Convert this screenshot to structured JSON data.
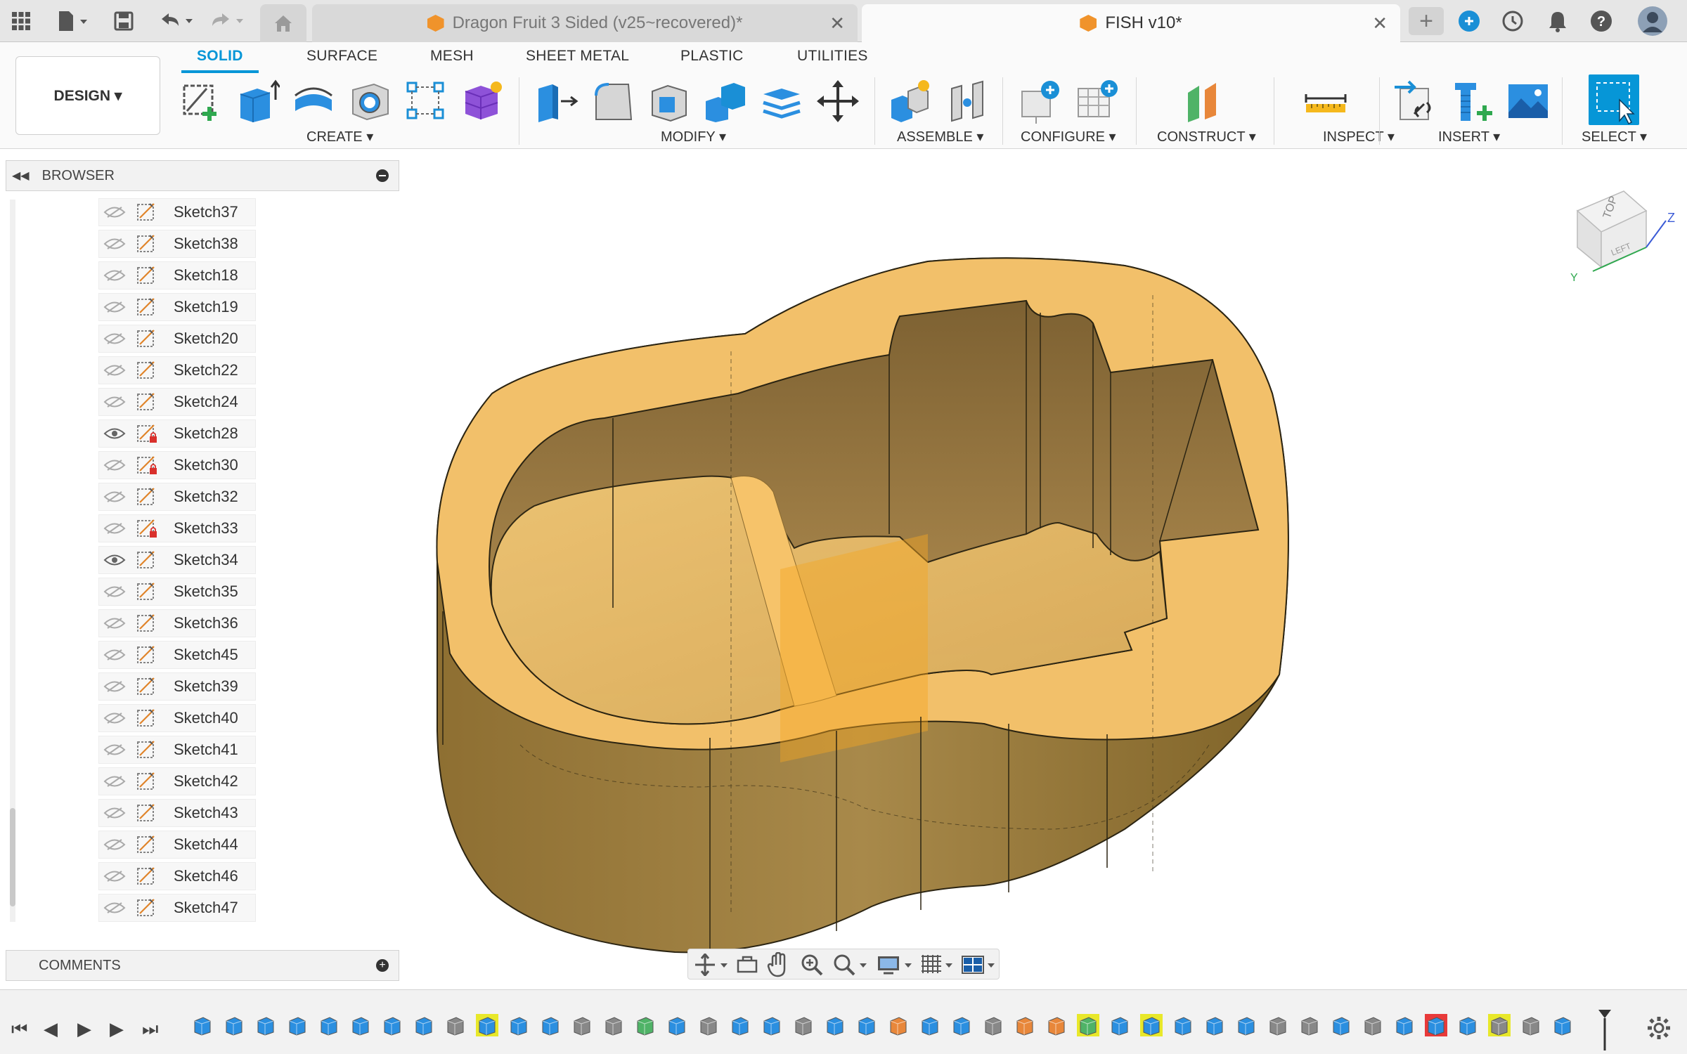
{
  "tabs": {
    "doc1_title": "Dragon Fruit 3 Sided (v25~recovered)*",
    "doc2_title": "FISH v10*"
  },
  "ribbon": {
    "tabs": [
      "SOLID",
      "SURFACE",
      "MESH",
      "SHEET METAL",
      "PLASTIC",
      "UTILITIES"
    ],
    "workspace": "DESIGN ▾",
    "groups": [
      "CREATE ▾",
      "MODIFY ▾",
      "ASSEMBLE ▾",
      "CONFIGURE ▾",
      "CONSTRUCT ▾",
      "INSPECT ▾",
      "INSERT ▾",
      "SELECT ▾"
    ]
  },
  "browser": {
    "title": "BROWSER",
    "items": [
      {
        "label": "Sketch37",
        "visible": false,
        "locked": false
      },
      {
        "label": "Sketch38",
        "visible": false,
        "locked": false
      },
      {
        "label": "Sketch18",
        "visible": false,
        "locked": false
      },
      {
        "label": "Sketch19",
        "visible": false,
        "locked": false
      },
      {
        "label": "Sketch20",
        "visible": false,
        "locked": false
      },
      {
        "label": "Sketch22",
        "visible": false,
        "locked": false
      },
      {
        "label": "Sketch24",
        "visible": false,
        "locked": false
      },
      {
        "label": "Sketch28",
        "visible": true,
        "locked": true
      },
      {
        "label": "Sketch30",
        "visible": false,
        "locked": true
      },
      {
        "label": "Sketch32",
        "visible": false,
        "locked": false
      },
      {
        "label": "Sketch33",
        "visible": false,
        "locked": true
      },
      {
        "label": "Sketch34",
        "visible": true,
        "locked": false
      },
      {
        "label": "Sketch35",
        "visible": false,
        "locked": false
      },
      {
        "label": "Sketch36",
        "visible": false,
        "locked": false
      },
      {
        "label": "Sketch45",
        "visible": false,
        "locked": false
      },
      {
        "label": "Sketch39",
        "visible": false,
        "locked": false
      },
      {
        "label": "Sketch40",
        "visible": false,
        "locked": false
      },
      {
        "label": "Sketch41",
        "visible": false,
        "locked": false
      },
      {
        "label": "Sketch42",
        "visible": false,
        "locked": false
      },
      {
        "label": "Sketch43",
        "visible": false,
        "locked": false
      },
      {
        "label": "Sketch44",
        "visible": false,
        "locked": false
      },
      {
        "label": "Sketch46",
        "visible": false,
        "locked": false
      },
      {
        "label": "Sketch47",
        "visible": false,
        "locked": false
      }
    ]
  },
  "comments": {
    "title": "COMMENTS"
  },
  "viewcube": {
    "top": "TOP",
    "left": "LEFT",
    "axis_z": "Z",
    "axis_y": "Y"
  },
  "colors": {
    "accent": "#0696d7",
    "body_face": "#f2c06a",
    "body_wall": "#a88544"
  }
}
